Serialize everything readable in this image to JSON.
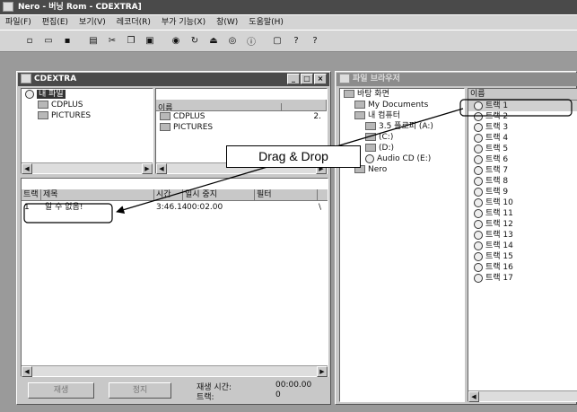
{
  "app": {
    "title": "Nero - 버닝 Rom - CDEXTRA]"
  },
  "menu": [
    "파일(F)",
    "편집(E)",
    "보기(V)",
    "레코더(R)",
    "부가 기능(X)",
    "창(W)",
    "도움말(H)"
  ],
  "toolbar_icons": [
    "new-icon",
    "open-icon",
    "save-icon",
    "properties-icon",
    "cut-icon",
    "copy-icon",
    "paste-icon",
    "burn-icon",
    "refresh-icon",
    "eject-icon",
    "disc-icon",
    "info-icon",
    "window-icon",
    "help-icon",
    "whatsthis-icon"
  ],
  "compilation": {
    "title": "CDEXTRA",
    "tree_root": "내 파일",
    "tree_items": [
      "CDPLUS",
      "PICTURES"
    ],
    "files_col": "이름",
    "files_col_size": "",
    "files": [
      "CDPLUS",
      "PICTURES"
    ],
    "files_size_mark": "2.",
    "track_headers": [
      "트랙",
      "제목",
      "시간",
      "일시 중지",
      "필터"
    ],
    "track_row": {
      "num": "1",
      "title": "알 수 없음!",
      "time": "3:46.14",
      "pause": "00:02.00",
      "filter": "\\"
    },
    "buttons": [
      "재생",
      "정지"
    ],
    "total_time_label": "재생 시간:",
    "total_time_value": "00:00.00",
    "tracks_label": "트랙:",
    "tracks_value": "0"
  },
  "browser": {
    "title": "파일 브라우저",
    "tree": [
      {
        "label": "바탕 화면",
        "indent": 0
      },
      {
        "label": "My Documents",
        "indent": 1
      },
      {
        "label": "내 컴퓨터",
        "indent": 1
      },
      {
        "label": "3.5 플로피 (A:)",
        "indent": 2
      },
      {
        "label": "(C:)",
        "indent": 2
      },
      {
        "label": "(D:)",
        "indent": 2
      },
      {
        "label": "Audio CD (E:)",
        "indent": 2
      },
      {
        "label": "Nero",
        "indent": 1
      }
    ],
    "list_header": "이름",
    "tracks": [
      "트랙 1",
      "트랙 2",
      "트랙 3",
      "트랙 4",
      "트랙 5",
      "트랙 6",
      "트랙 7",
      "트랙 8",
      "트랙 9",
      "트랙 10",
      "트랙 11",
      "트랙 12",
      "트랙 13",
      "트랙 14",
      "트랙 15",
      "트랙 16",
      "트랙 17"
    ]
  },
  "annotation": {
    "label": "Drag & Drop"
  }
}
